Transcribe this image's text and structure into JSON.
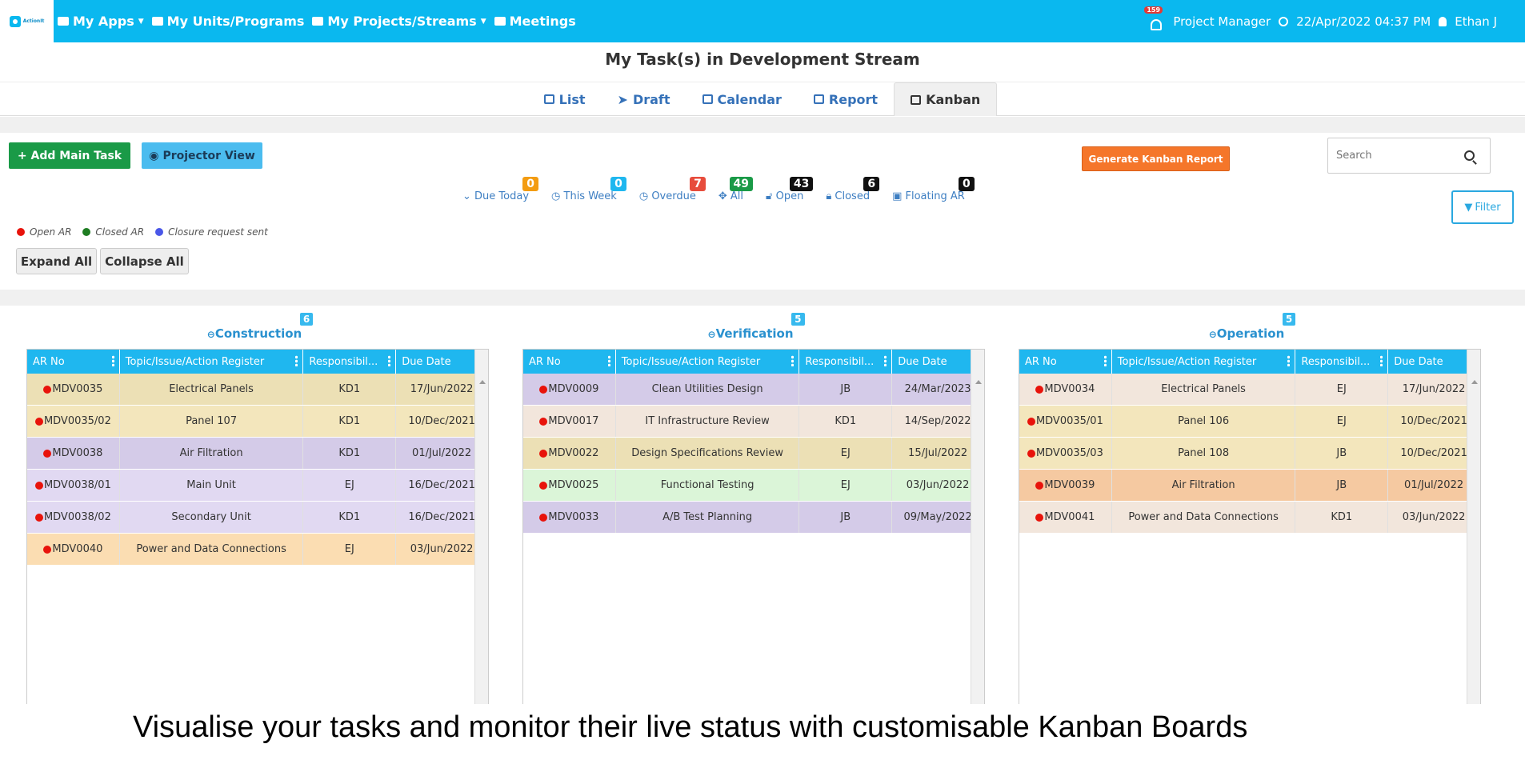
{
  "app": {
    "logo_text": "ActionIt"
  },
  "nav": {
    "items": [
      {
        "label": "My Apps",
        "caret": true
      },
      {
        "label": "My Units/Programs",
        "caret": false
      },
      {
        "label": "My Projects/Streams",
        "caret": true
      },
      {
        "label": "Meetings",
        "caret": false
      }
    ],
    "notification_count": "159",
    "role": "Project Manager",
    "datetime": "22/Apr/2022 04:37 PM",
    "user": "Ethan J"
  },
  "page": {
    "title": "My Task(s) in Development Stream"
  },
  "tabs": [
    {
      "label": "List",
      "active": false
    },
    {
      "label": "Draft",
      "active": false
    },
    {
      "label": "Calendar",
      "active": false
    },
    {
      "label": "Report",
      "active": false
    },
    {
      "label": "Kanban",
      "active": true
    }
  ],
  "toolbar": {
    "add_main_task": "+ Add Main Task",
    "projector_view": "Projector View",
    "generate_report": "Generate Kanban Report",
    "search_placeholder": "Search",
    "filter": "Filter",
    "expand_all": "Expand All",
    "collapse_all": "Collapse All"
  },
  "stats": [
    {
      "label": "Due Today",
      "count": "0",
      "color": "#f39c12"
    },
    {
      "label": "This Week",
      "count": "0",
      "color": "#1fb7ef"
    },
    {
      "label": "Overdue",
      "count": "7",
      "color": "#e74c3c"
    },
    {
      "label": "All",
      "count": "49",
      "color": "#1a9a47"
    },
    {
      "label": "Open",
      "count": "43",
      "color": "#111111"
    },
    {
      "label": "Closed",
      "count": "6",
      "color": "#111111"
    },
    {
      "label": "Floating AR",
      "count": "0",
      "color": "#111111"
    }
  ],
  "legend": [
    {
      "label": "Open AR",
      "color": "#e8130b"
    },
    {
      "label": "Closed AR",
      "color": "#1e7d22"
    },
    {
      "label": "Closure request sent",
      "color": "#4a57e8"
    }
  ],
  "columns_header": [
    "AR No",
    "Topic/Issue/Action Register",
    "Responsibil...",
    "Due Date"
  ],
  "columns": [
    {
      "title": "Construction",
      "count": "6",
      "rows": [
        {
          "ar": "MDV0035",
          "topic": "Electrical Panels",
          "resp": "KD1",
          "due": "17/Jun/2022",
          "bg": "#ece0b5"
        },
        {
          "ar": "MDV0035/02",
          "topic": "Panel 107",
          "resp": "KD1",
          "due": "10/Dec/2021",
          "bg": "#f3e6bc"
        },
        {
          "ar": "MDV0038",
          "topic": "Air Filtration",
          "resp": "KD1",
          "due": "01/Jul/2022",
          "bg": "#d4cbe8"
        },
        {
          "ar": "MDV0038/01",
          "topic": "Main Unit",
          "resp": "EJ",
          "due": "16/Dec/2021",
          "bg": "#e1d9f2"
        },
        {
          "ar": "MDV0038/02",
          "topic": "Secondary Unit",
          "resp": "KD1",
          "due": "16/Dec/2021",
          "bg": "#e1d9f2"
        },
        {
          "ar": "MDV0040",
          "topic": "Power and Data Connections",
          "resp": "EJ",
          "due": "03/Jun/2022",
          "bg": "#fbddb2"
        }
      ]
    },
    {
      "title": "Verification",
      "count": "5",
      "rows": [
        {
          "ar": "MDV0009",
          "topic": "Clean Utilities Design",
          "resp": "JB",
          "due": "24/Mar/2023",
          "bg": "#d4cbe8"
        },
        {
          "ar": "MDV0017",
          "topic": "IT Infrastructure Review",
          "resp": "KD1",
          "due": "14/Sep/2022",
          "bg": "#f2e6dc"
        },
        {
          "ar": "MDV0022",
          "topic": "Design Specifications Review",
          "resp": "EJ",
          "due": "15/Jul/2022",
          "bg": "#ece0b5"
        },
        {
          "ar": "MDV0025",
          "topic": "Functional Testing",
          "resp": "EJ",
          "due": "03/Jun/2022",
          "bg": "#dbf5d8"
        },
        {
          "ar": "MDV0033",
          "topic": "A/B Test Planning",
          "resp": "JB",
          "due": "09/May/2022",
          "bg": "#d4cbe8"
        }
      ]
    },
    {
      "title": "Operation",
      "count": "5",
      "rows": [
        {
          "ar": "MDV0034",
          "topic": "Electrical Panels",
          "resp": "EJ",
          "due": "17/Jun/2022",
          "bg": "#f2e6dc"
        },
        {
          "ar": "MDV0035/01",
          "topic": "Panel 106",
          "resp": "EJ",
          "due": "10/Dec/2021",
          "bg": "#f3e6bc"
        },
        {
          "ar": "MDV0035/03",
          "topic": "Panel 108",
          "resp": "JB",
          "due": "10/Dec/2021",
          "bg": "#f3e6bc"
        },
        {
          "ar": "MDV0039",
          "topic": "Air Filtration",
          "resp": "JB",
          "due": "01/Jul/2022",
          "bg": "#f5c9a1"
        },
        {
          "ar": "MDV0041",
          "topic": "Power and Data Connections",
          "resp": "KD1",
          "due": "03/Jun/2022",
          "bg": "#f2e6dc"
        }
      ]
    }
  ],
  "caption": "Visualise your tasks and monitor their live status with customisable Kanban Boards"
}
